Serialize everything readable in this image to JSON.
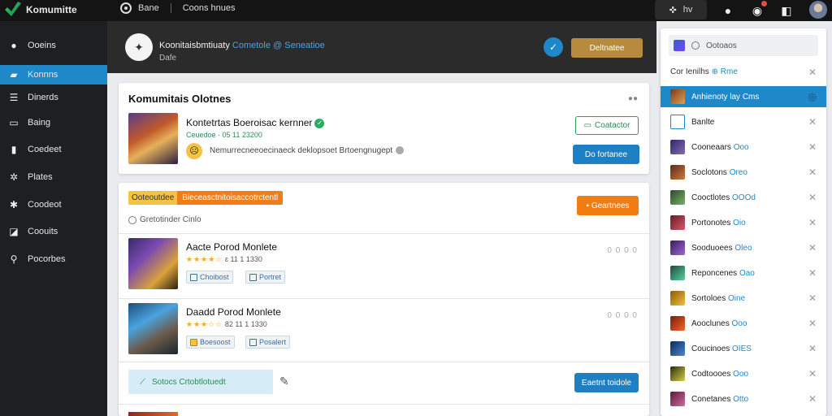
{
  "topbar": {
    "app_name": "Komumitte",
    "home_label": "Bane",
    "breadcrumb": "Coons hnues",
    "pill_text": "hv"
  },
  "sidebar": {
    "items": [
      {
        "label": "Ooeins",
        "icon": "pin-icon"
      },
      {
        "label": "Konnns",
        "icon": "folder-icon",
        "active": true
      },
      {
        "label": "Dinerds",
        "icon": "list-icon"
      },
      {
        "label": "Baing",
        "icon": "card-icon"
      },
      {
        "label": "Coedeet",
        "icon": "chart-icon"
      },
      {
        "label": "Plates",
        "icon": "gear-icon"
      },
      {
        "label": "Coodeot",
        "icon": "star-icon"
      },
      {
        "label": "Coouits",
        "icon": "tag-icon"
      },
      {
        "label": "Pocorbes",
        "icon": "search-icon"
      }
    ]
  },
  "header": {
    "title": "Koonitaisbmtiuaty",
    "title_accent": "Cometole @ Seneatioe",
    "subtitle": "Dafe",
    "button_label": "Deltnatee"
  },
  "card1": {
    "title": "Komumitais Olotnes",
    "profile_name": "Kontetrtas Boeroisac kernner",
    "meta": "Ceuedoe · 05 11 23200",
    "description": "Nemurrecneeoecinaeck deklopsoet Brtoengnugept",
    "follow_label": "Coatactor",
    "action_label": "Do fortanee"
  },
  "card2": {
    "badge_left": "Ooteoutdee",
    "badge_right": "Bieceasctnitoisaccotrctentl",
    "subtitle": "Gretotinder Cinlo",
    "orange_button": "Geartnees",
    "games": [
      {
        "title": "Aacte Porod Monlete",
        "stars": "★★★★☆",
        "rating": "ɛ 11 1 1330",
        "tag1": "Choibost",
        "tag2": "Portret",
        "count": "0 0 0 0"
      },
      {
        "title": "Daadd Porod Monlete",
        "stars": "★★★☆☆",
        "rating": "82 11 1 1330",
        "tag1": "Boesoost",
        "tag2": "Posalert",
        "count": "0 0 0 0"
      }
    ],
    "promo_text": "Sotocs Crtobtlotuedt",
    "promo_button": "Eaetnt toidole"
  },
  "rpanel": {
    "search_placeholder": "Ootoaos",
    "header_text": "Cor Ienilhs",
    "header_accent": "Rme",
    "items": [
      {
        "name": "Anhienoty lay",
        "accent": "Cms",
        "active": true
      },
      {
        "name": "Banlte",
        "accent": ""
      },
      {
        "name": "Cooneaars",
        "accent": "Ooo"
      },
      {
        "name": "Soclotons",
        "accent": "Oreo"
      },
      {
        "name": "Cooctlotes",
        "accent": "OOOd"
      },
      {
        "name": "Portonotes",
        "accent": "Oio"
      },
      {
        "name": "Sooduoees",
        "accent": "Oleo"
      },
      {
        "name": "Reponcenes",
        "accent": "Oao"
      },
      {
        "name": "Sortoloes",
        "accent": "Oine"
      },
      {
        "name": "Aooclunes",
        "accent": "Ooo"
      },
      {
        "name": "Coucinoes",
        "accent": "OIES"
      },
      {
        "name": "Codtoooes",
        "accent": "Ooo"
      },
      {
        "name": "Conetanes",
        "accent": "Otto"
      }
    ]
  },
  "colors": {
    "accent_blue": "#1e88c9",
    "accent_orange": "#f07c12",
    "accent_gold": "#b88a3e",
    "success_green": "#2e9e5b"
  }
}
